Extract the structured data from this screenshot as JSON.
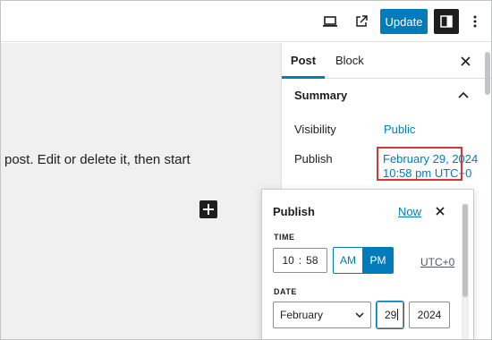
{
  "toolbar": {
    "view_icon": "laptop-icon",
    "external_icon": "external-link-icon",
    "update_label": "Update",
    "settings_icon": "sidebar-toggle-icon",
    "more_icon": "vertical-ellipsis-icon"
  },
  "canvas": {
    "text": "post. Edit or delete it, then start",
    "inserter_icon": "plus-icon"
  },
  "sidebar": {
    "tabs": [
      {
        "label": "Post",
        "active": true
      },
      {
        "label": "Block",
        "active": false
      }
    ],
    "close_icon": "close-icon",
    "panel": {
      "title": "Summary",
      "toggle_icon": "chevron-up-icon",
      "visibility_label": "Visibility",
      "visibility_value": "Public",
      "publish_label": "Publish",
      "publish_date": "February 29, 2024",
      "publish_time": "10:58 pm UTC+0"
    }
  },
  "popover": {
    "title": "Publish",
    "now_label": "Now",
    "close_icon": "close-icon",
    "time_label": "TIME",
    "hours": "10",
    "separator": ":",
    "minutes": "58",
    "am_label": "AM",
    "pm_label": "PM",
    "selected_period": "PM",
    "timezone": "UTC+0",
    "date_label": "DATE",
    "month": "February",
    "day": "29",
    "year": "2024"
  },
  "colors": {
    "accent": "#007cba",
    "highlight": "#d63638",
    "dark": "#1e1e1e"
  }
}
